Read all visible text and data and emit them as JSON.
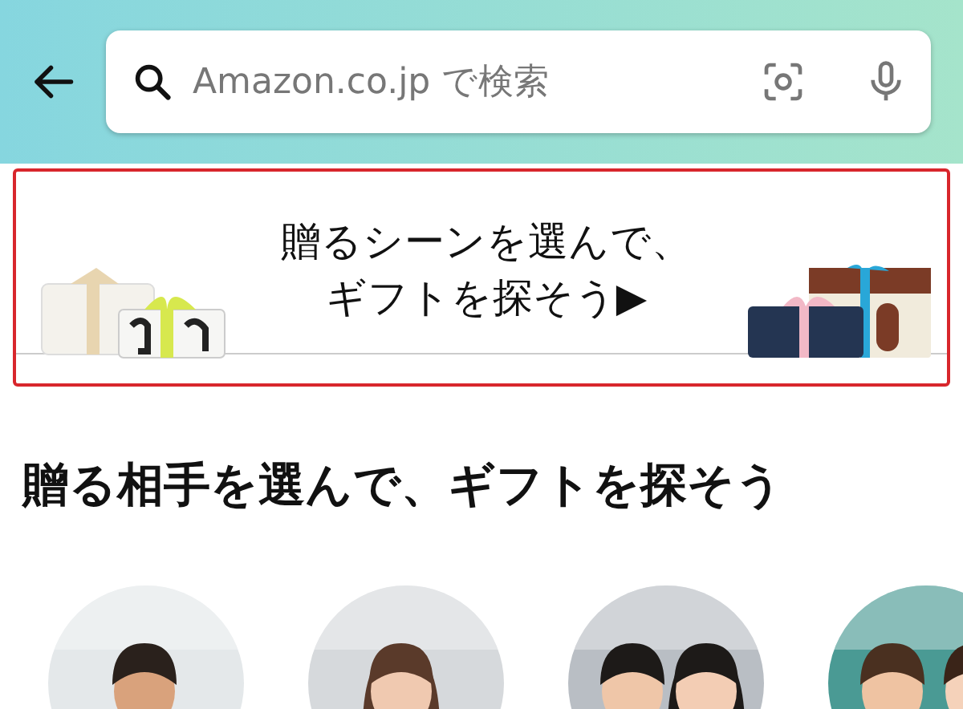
{
  "header": {
    "search": {
      "placeholder": "Amazon.co.jp で検索"
    }
  },
  "banner": {
    "lines": [
      "贈るシーンを選んで、",
      "ギフトを探そう▶"
    ],
    "highlighted": true
  },
  "section": {
    "title": "贈る相手を選んで、ギフトを探そう"
  }
}
